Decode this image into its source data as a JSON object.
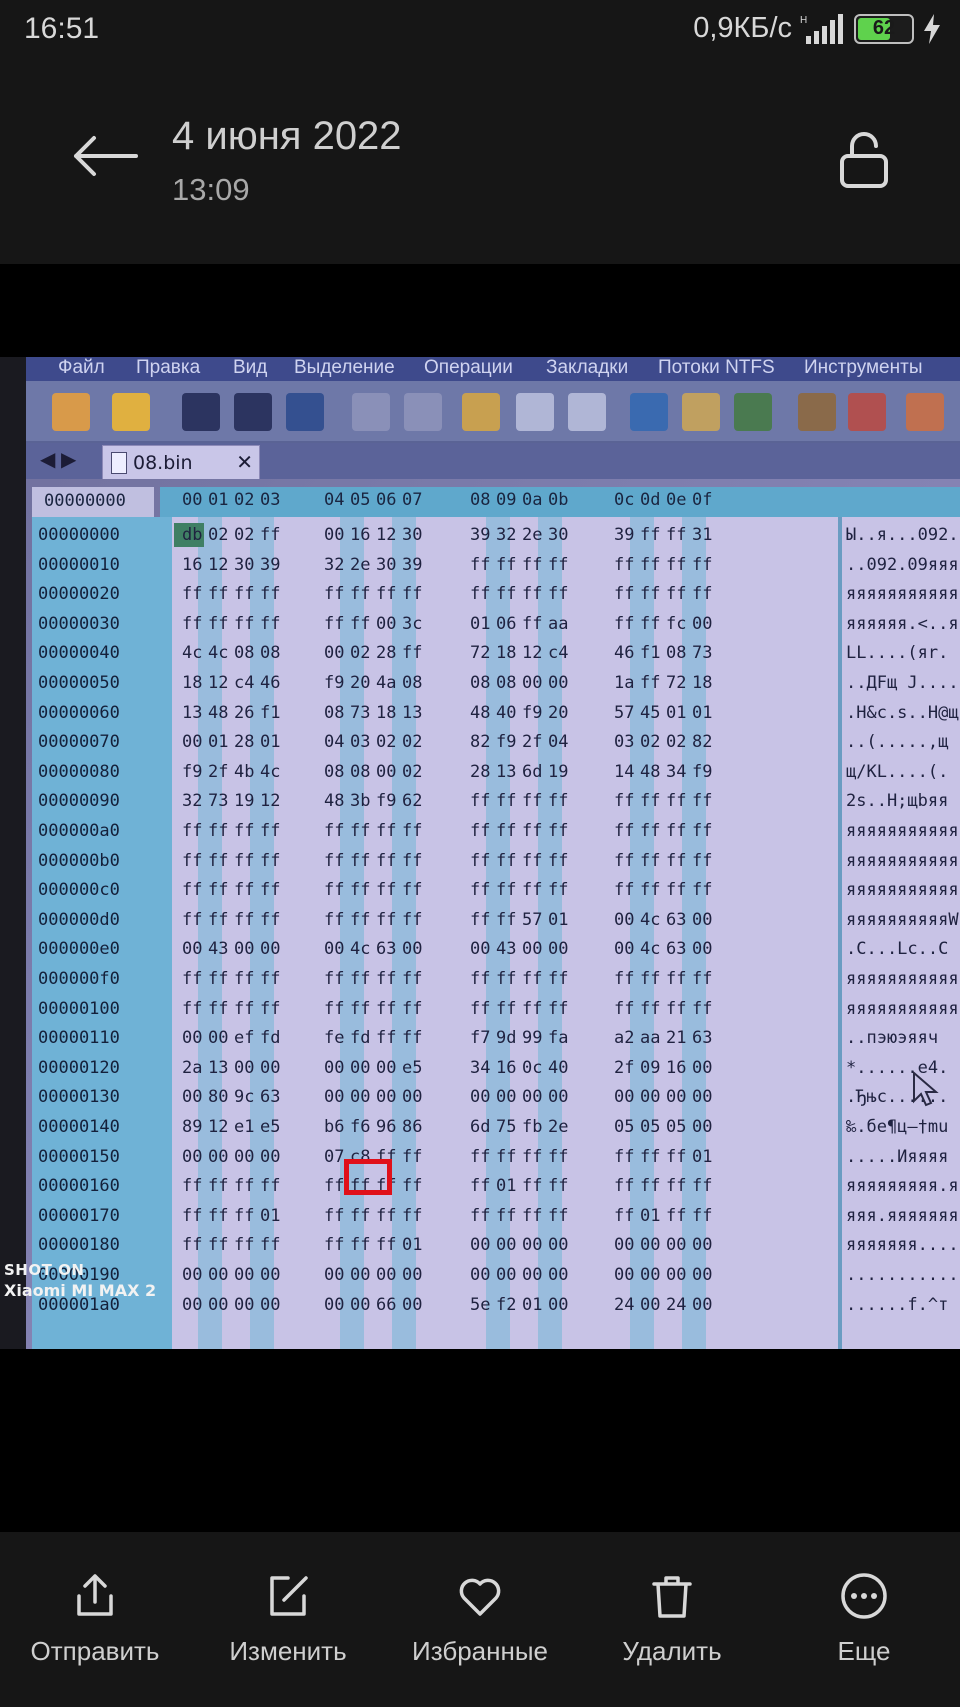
{
  "status_bar": {
    "time": "16:51",
    "network_speed": "0,9КБ/с",
    "network_type": "H",
    "battery_level": "62",
    "battery_fraction": 0.62,
    "icons": [
      "signal-icon",
      "battery-icon",
      "charging-icon"
    ]
  },
  "header": {
    "date": "4 июня 2022",
    "time": "13:09",
    "back_icon": "arrow-left-icon",
    "lock_icon": "unlock-icon"
  },
  "photo": {
    "menu": [
      "Файл",
      "Правка",
      "Вид",
      "Выделение",
      "Операции",
      "Закладки",
      "Потоки NTFS",
      "Инструменты"
    ],
    "tab_label": "08.bin",
    "offset_header": "00000000",
    "column_headers": [
      "00",
      "01",
      "02",
      "03",
      "04",
      "05",
      "06",
      "07",
      "08",
      "09",
      "0a",
      "0b",
      "0c",
      "0d",
      "0e",
      "0f"
    ],
    "rows": [
      {
        "offset": "00000000",
        "hex": [
          "db",
          "02",
          "02",
          "ff",
          "00",
          "16",
          "12",
          "30",
          "39",
          "32",
          "2e",
          "30",
          "39",
          "ff",
          "ff",
          "31"
        ],
        "ascii": "Ы..я...092."
      },
      {
        "offset": "00000010",
        "hex": [
          "16",
          "12",
          "30",
          "39",
          "32",
          "2e",
          "30",
          "39",
          "ff",
          "ff",
          "ff",
          "ff",
          "ff",
          "ff",
          "ff",
          "ff"
        ],
        "ascii": "..092.09яяя"
      },
      {
        "offset": "00000020",
        "hex": [
          "ff",
          "ff",
          "ff",
          "ff",
          "ff",
          "ff",
          "ff",
          "ff",
          "ff",
          "ff",
          "ff",
          "ff",
          "ff",
          "ff",
          "ff",
          "ff"
        ],
        "ascii": "яяяяяяяяяяя"
      },
      {
        "offset": "00000030",
        "hex": [
          "ff",
          "ff",
          "ff",
          "ff",
          "ff",
          "ff",
          "00",
          "3c",
          "01",
          "06",
          "ff",
          "aa",
          "ff",
          "ff",
          "fc",
          "00"
        ],
        "ascii": "яяяяяя.<..я"
      },
      {
        "offset": "00000040",
        "hex": [
          "4c",
          "4c",
          "08",
          "08",
          "00",
          "02",
          "28",
          "ff",
          "72",
          "18",
          "12",
          "c4",
          "46",
          "f1",
          "08",
          "73"
        ],
        "ascii": "LL....(яr."
      },
      {
        "offset": "00000050",
        "hex": [
          "18",
          "12",
          "c4",
          "46",
          "f9",
          "20",
          "4a",
          "08",
          "08",
          "08",
          "00",
          "00",
          "1a",
          "ff",
          "72",
          "18"
        ],
        "ascii": "..ДFщ J...."
      },
      {
        "offset": "00000060",
        "hex": [
          "13",
          "48",
          "26",
          "f1",
          "08",
          "73",
          "18",
          "13",
          "48",
          "40",
          "f9",
          "20",
          "57",
          "45",
          "01",
          "01"
        ],
        "ascii": ".H&с.s..H@щ"
      },
      {
        "offset": "00000070",
        "hex": [
          "00",
          "01",
          "28",
          "01",
          "04",
          "03",
          "02",
          "02",
          "82",
          "f9",
          "2f",
          "04",
          "03",
          "02",
          "02",
          "82"
        ],
        "ascii": "..(.....,щ"
      },
      {
        "offset": "00000080",
        "hex": [
          "f9",
          "2f",
          "4b",
          "4c",
          "08",
          "08",
          "00",
          "02",
          "28",
          "13",
          "6d",
          "19",
          "14",
          "48",
          "34",
          "f9"
        ],
        "ascii": "щ/KL....(."
      },
      {
        "offset": "00000090",
        "hex": [
          "32",
          "73",
          "19",
          "12",
          "48",
          "3b",
          "f9",
          "62",
          "ff",
          "ff",
          "ff",
          "ff",
          "ff",
          "ff",
          "ff",
          "ff"
        ],
        "ascii": "2s..H;щbяя"
      },
      {
        "offset": "000000a0",
        "hex": [
          "ff",
          "ff",
          "ff",
          "ff",
          "ff",
          "ff",
          "ff",
          "ff",
          "ff",
          "ff",
          "ff",
          "ff",
          "ff",
          "ff",
          "ff",
          "ff"
        ],
        "ascii": "яяяяяяяяяяя"
      },
      {
        "offset": "000000b0",
        "hex": [
          "ff",
          "ff",
          "ff",
          "ff",
          "ff",
          "ff",
          "ff",
          "ff",
          "ff",
          "ff",
          "ff",
          "ff",
          "ff",
          "ff",
          "ff",
          "ff"
        ],
        "ascii": "яяяяяяяяяяя"
      },
      {
        "offset": "000000c0",
        "hex": [
          "ff",
          "ff",
          "ff",
          "ff",
          "ff",
          "ff",
          "ff",
          "ff",
          "ff",
          "ff",
          "ff",
          "ff",
          "ff",
          "ff",
          "ff",
          "ff"
        ],
        "ascii": "яяяяяяяяяяя"
      },
      {
        "offset": "000000d0",
        "hex": [
          "ff",
          "ff",
          "ff",
          "ff",
          "ff",
          "ff",
          "ff",
          "ff",
          "ff",
          "ff",
          "57",
          "01",
          "00",
          "4c",
          "63",
          "00"
        ],
        "ascii": "яяяяяяяяяяW"
      },
      {
        "offset": "000000e0",
        "hex": [
          "00",
          "43",
          "00",
          "00",
          "00",
          "4c",
          "63",
          "00",
          "00",
          "43",
          "00",
          "00",
          "00",
          "4c",
          "63",
          "00"
        ],
        "ascii": ".C...Lc..C"
      },
      {
        "offset": "000000f0",
        "hex": [
          "ff",
          "ff",
          "ff",
          "ff",
          "ff",
          "ff",
          "ff",
          "ff",
          "ff",
          "ff",
          "ff",
          "ff",
          "ff",
          "ff",
          "ff",
          "ff"
        ],
        "ascii": "яяяяяяяяяяя"
      },
      {
        "offset": "00000100",
        "hex": [
          "ff",
          "ff",
          "ff",
          "ff",
          "ff",
          "ff",
          "ff",
          "ff",
          "ff",
          "ff",
          "ff",
          "ff",
          "ff",
          "ff",
          "ff",
          "ff"
        ],
        "ascii": "яяяяяяяяяяя"
      },
      {
        "offset": "00000110",
        "hex": [
          "00",
          "00",
          "ef",
          "fd",
          "fe",
          "fd",
          "ff",
          "ff",
          "f7",
          "9d",
          "99",
          "fa",
          "a2",
          "aa",
          "21",
          "63"
        ],
        "ascii": "..пэюэяяч"
      },
      {
        "offset": "00000120",
        "hex": [
          "2a",
          "13",
          "00",
          "00",
          "00",
          "00",
          "00",
          "e5",
          "34",
          "16",
          "0c",
          "40",
          "2f",
          "09",
          "16",
          "00"
        ],
        "ascii": "*......e4."
      },
      {
        "offset": "00000130",
        "hex": [
          "00",
          "80",
          "9c",
          "63",
          "00",
          "00",
          "00",
          "00",
          "00",
          "00",
          "00",
          "00",
          "00",
          "00",
          "00",
          "00"
        ],
        "ascii": ".Ђњc......"
      },
      {
        "offset": "00000140",
        "hex": [
          "89",
          "12",
          "e1",
          "e5",
          "b6",
          "f6",
          "96",
          "86",
          "6d",
          "75",
          "fb",
          "2e",
          "05",
          "05",
          "05",
          "00"
        ],
        "ascii": "‰.бе¶ц–†mu"
      },
      {
        "offset": "00000150",
        "hex": [
          "00",
          "00",
          "00",
          "00",
          "07",
          "c8",
          "ff",
          "ff",
          "ff",
          "ff",
          "ff",
          "ff",
          "ff",
          "ff",
          "ff",
          "01"
        ],
        "ascii": ".....Ияяяя"
      },
      {
        "offset": "00000160",
        "hex": [
          "ff",
          "ff",
          "ff",
          "ff",
          "ff",
          "ff",
          "ff",
          "ff",
          "ff",
          "01",
          "ff",
          "ff",
          "ff",
          "ff",
          "ff",
          "ff"
        ],
        "ascii": "яяяяяяяяя.я"
      },
      {
        "offset": "00000170",
        "hex": [
          "ff",
          "ff",
          "ff",
          "01",
          "ff",
          "ff",
          "ff",
          "ff",
          "ff",
          "ff",
          "ff",
          "ff",
          "ff",
          "01",
          "ff",
          "ff"
        ],
        "ascii": "яяя.яяяяяяя"
      },
      {
        "offset": "00000180",
        "hex": [
          "ff",
          "ff",
          "ff",
          "ff",
          "ff",
          "ff",
          "ff",
          "01",
          "00",
          "00",
          "00",
          "00",
          "00",
          "00",
          "00",
          "00"
        ],
        "ascii": "яяяяяяя...."
      },
      {
        "offset": "00000190",
        "hex": [
          "00",
          "00",
          "00",
          "00",
          "00",
          "00",
          "00",
          "00",
          "00",
          "00",
          "00",
          "00",
          "00",
          "00",
          "00",
          "00"
        ],
        "ascii": "..........."
      },
      {
        "offset": "000001a0",
        "hex": [
          "00",
          "00",
          "00",
          "00",
          "00",
          "00",
          "66",
          "00",
          "5e",
          "f2",
          "01",
          "00",
          "24",
          "00",
          "24",
          "00"
        ],
        "ascii": "......f.^т"
      }
    ],
    "watermark_line1": "SHOT ON",
    "watermark_line2": "Xiaomi MI MAX 2",
    "highlight_color": "#e0101a"
  },
  "actions": [
    {
      "label": "Отправить",
      "icon": "share-icon"
    },
    {
      "label": "Изменить",
      "icon": "edit-icon"
    },
    {
      "label": "Избранные",
      "icon": "heart-icon"
    },
    {
      "label": "Удалить",
      "icon": "trash-icon"
    },
    {
      "label": "Еще",
      "icon": "more-icon"
    }
  ]
}
